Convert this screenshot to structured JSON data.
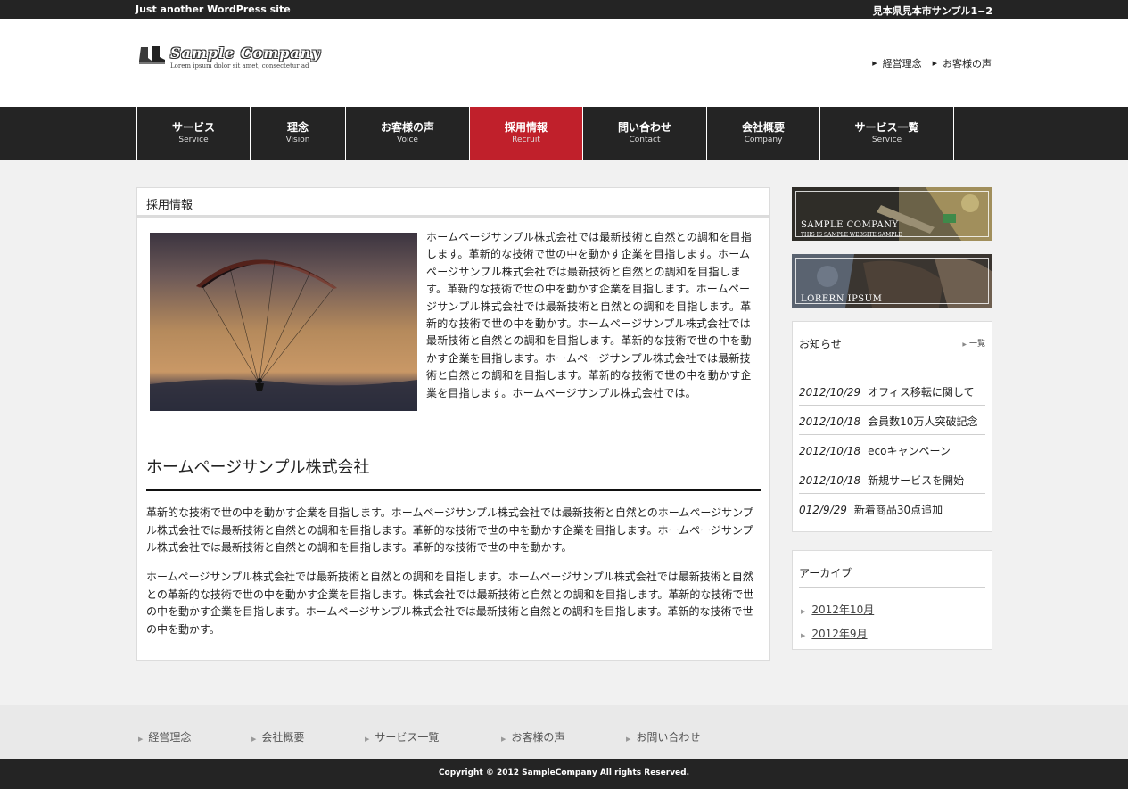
{
  "topbar": {
    "tagline": "Just another WordPress site",
    "address": "見本県見本市サンプル1−2"
  },
  "header": {
    "logo_name": "Sample Company",
    "logo_sub": "Lorem ipsum dolor sit amet, consectetur ad",
    "links": [
      "経営理念",
      "お客様の声"
    ]
  },
  "nav": {
    "items": [
      {
        "jp": "サービス",
        "en": "Service"
      },
      {
        "jp": "理念",
        "en": "Vision"
      },
      {
        "jp": "お客様の声",
        "en": "Voice"
      },
      {
        "jp": "採用情報",
        "en": "Recruit"
      },
      {
        "jp": "問い合わせ",
        "en": "Contact"
      },
      {
        "jp": "会社概要",
        "en": "Company"
      },
      {
        "jp": "サービス一覧",
        "en": "Service"
      }
    ],
    "active_index": 3,
    "active_color": "#c0202b"
  },
  "main": {
    "page_title": "採用情報",
    "photo_icon": "paraglider-sunset-photo",
    "intro_text": "ホームページサンプル株式会社では最新技術と自然との調和を目指します。革新的な技術で世の中を動かす企業を目指します。ホームページサンプル株式会社では最新技術と自然との調和を目指します。革新的な技術で世の中を動かす企業を目指します。ホームページサンプル株式会社では最新技術と自然との調和を目指します。革新的な技術で世の中を動かす。ホームページサンプル株式会社では最新技術と自然との調和を目指します。革新的な技術で世の中を動かす企業を目指します。ホームページサンプル株式会社では最新技術と自然との調和を目指します。革新的な技術で世の中を動かす企業を目指します。ホームページサンプル株式会社では。",
    "sub_heading": "ホームページサンプル株式会社",
    "para1": "革新的な技術で世の中を動かす企業を目指します。ホームページサンプル株式会社では最新技術と自然とのホームページサンプル株式会社では最新技術と自然との調和を目指します。革新的な技術で世の中を動かす企業を目指します。ホームページサンプル株式会社では最新技術と自然との調和を目指します。革新的な技術で世の中を動かす。",
    "para2": "ホームページサンプル株式会社では最新技術と自然との調和を目指します。ホームページサンプル株式会社では最新技術と自然との革新的な技術で世の中を動かす企業を目指します。株式会社では最新技術と自然との調和を目指します。革新的な技術で世の中を動かす企業を目指します。ホームページサンプル株式会社では最新技術と自然との調和を目指します。革新的な技術で世の中を動かす。"
  },
  "sidebar": {
    "banner1": {
      "title": "SAMPLE COMPANY",
      "sub": "THIS IS SAMPLE WEBSITE SAMPLE"
    },
    "banner2": {
      "title": "LORERN IPSUM"
    },
    "news": {
      "title": "お知らせ",
      "more": "一覧",
      "items": [
        {
          "date": "2012/10/29",
          "text": "オフィス移転に関して"
        },
        {
          "date": "2012/10/18",
          "text": "会員数10万人突破記念"
        },
        {
          "date": "2012/10/18",
          "text": "ecoキャンペーン"
        },
        {
          "date": "2012/10/18",
          "text": "新規サービスを開始"
        },
        {
          "date": "012/9/29",
          "text": "新着商品30点追加"
        }
      ]
    },
    "archive": {
      "title": "アーカイブ",
      "items": [
        "2012年10月",
        "2012年9月"
      ]
    }
  },
  "footer": {
    "links": [
      "経営理念",
      "会社概要",
      "サービス一覧",
      "お客様の声",
      "お問い合わせ"
    ],
    "copyright": "Copyright © 2012 SampleCompany All rights Reserved."
  }
}
